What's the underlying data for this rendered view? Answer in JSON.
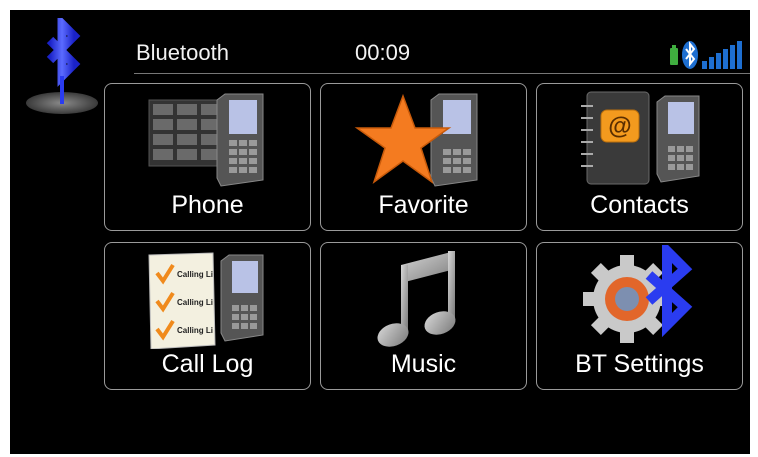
{
  "status_bar": {
    "title": "Bluetooth",
    "time": "00:09"
  },
  "menu": {
    "items": [
      {
        "label": "Phone",
        "icon": "phone-dialpad-icon"
      },
      {
        "label": "Favorite",
        "icon": "star-phone-icon"
      },
      {
        "label": "Contacts",
        "icon": "address-book-icon"
      },
      {
        "label": "Call Log",
        "icon": "call-log-icon"
      },
      {
        "label": "Music",
        "icon": "music-note-icon"
      },
      {
        "label": "BT Settings",
        "icon": "bluetooth-gear-icon"
      }
    ]
  },
  "call_log_icon_text": "Calling Li",
  "colors": {
    "background": "#000000",
    "tile_border": "#9a9a9a",
    "bluetooth_blue": "#2a3cf0",
    "star_orange": "#f47b20",
    "signal_blue": "#1e6fd1",
    "battery_green": "#3fae3f"
  }
}
